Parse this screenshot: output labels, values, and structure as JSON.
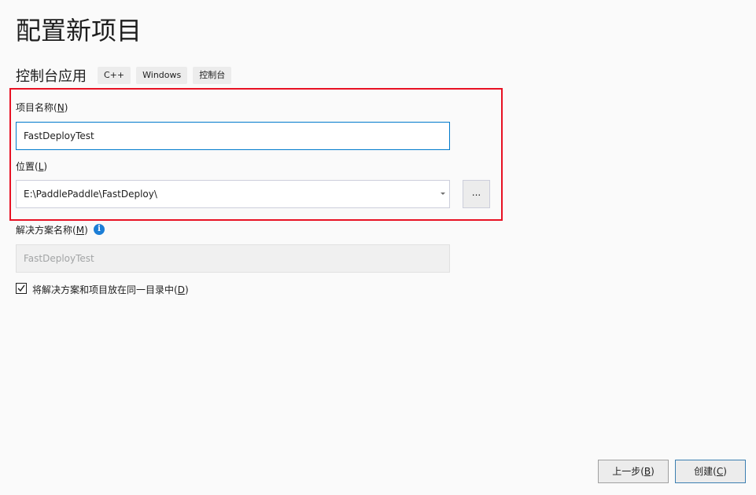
{
  "page": {
    "title": "配置新项目"
  },
  "template": {
    "name": "控制台应用",
    "tags": [
      "C++",
      "Windows",
      "控制台"
    ]
  },
  "project_name": {
    "label": "项目名称",
    "accelerator": "N",
    "value": "FastDeployTest"
  },
  "location": {
    "label": "位置",
    "accelerator": "L",
    "value": "E:\\PaddlePaddle\\FastDeploy\\",
    "browse_label": "..."
  },
  "solution_name": {
    "label": "解决方案名称",
    "accelerator": "M",
    "value": "FastDeployTest",
    "info_icon": "info-icon"
  },
  "same_directory": {
    "label": "将解决方案和项目放在同一目录中",
    "accelerator": "D",
    "checked": true
  },
  "footer": {
    "back_label": "上一步",
    "back_accelerator": "B",
    "create_label": "创建",
    "create_accelerator": "C"
  },
  "colors": {
    "highlight": "#e81123",
    "focus_border": "#007acc",
    "info": "#1c7ed6",
    "background": "#fafafa"
  }
}
